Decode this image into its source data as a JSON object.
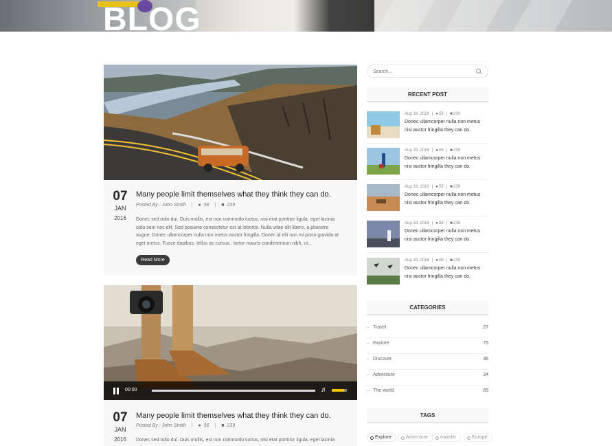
{
  "hero": {
    "title": "BLOG"
  },
  "posts": [
    {
      "day": "07",
      "month": "JAN",
      "year": "2016",
      "title": "Many people limit themselves what they think they can do.",
      "author": "Posted By : John Smith",
      "likes": "56",
      "comments": "239",
      "excerpt": "Donec sed odio dui. Duis mollis, est non commodo luctus, nisi erat porttitor ligula, eget lacinia odio sem nec elit. Sed posuere consectetur est at lobortis. Nulla vitae elit libero, a pharetra augue. Donec ullamcorper nulla non metus auctor fringilla. Donec id elit non mi porta gravida at eget metus. Fusce dapibus, tellus ac cursus , tortor mauris condimentum nibh, ut...",
      "read_more": "Read More"
    },
    {
      "day": "07",
      "month": "JAN",
      "year": "2016",
      "title": "Many people limit themselves what they think they can do.",
      "author": "Posted By : John Smith",
      "likes": "56",
      "comments": "239",
      "excerpt": "Donec sed odio dui. Duis mollis, est non commodo luctus, nisi erat porttitor ligula, eget lacinia odio",
      "video_time": "00:00",
      "volume_level": 0.8
    }
  ],
  "sidebar": {
    "search_placeholder": "Search...",
    "recent_title": "RECENT POST",
    "recent": [
      {
        "date": "Aug 18, 2016",
        "likes": "56",
        "comments": "239",
        "text": "Donec ullamcorper nulla non metus nisi auctor fringilla they can do."
      },
      {
        "date": "Aug 18, 2016",
        "likes": "56",
        "comments": "239",
        "text": "Donec ullamcorper nulla non metus nisi auctor fringilla they can do."
      },
      {
        "date": "Aug 18, 2016",
        "likes": "56",
        "comments": "239",
        "text": "Donec ullamcorper nulla non metus nisi auctor fringilla they can do."
      },
      {
        "date": "Aug 18, 2016",
        "likes": "56",
        "comments": "239",
        "text": "Donec ullamcorper nulla non metus nisi auctor fringilla they can do."
      },
      {
        "date": "Aug 18, 2016",
        "likes": "56",
        "comments": "239",
        "text": "Donec ullamcorper nulla non metus nisi auctor fringilla they can do."
      }
    ],
    "categories_title": "CATEGORIES",
    "categories": [
      {
        "name": "Travel",
        "count": "27"
      },
      {
        "name": "Explore",
        "count": "75"
      },
      {
        "name": "Discover",
        "count": "35"
      },
      {
        "name": "Adventure",
        "count": "34"
      },
      {
        "name": "The world",
        "count": "65"
      }
    ],
    "tags_title": "TAGS",
    "tags": [
      "Explore",
      "Adventure",
      "traveler",
      "Europe"
    ]
  },
  "icons": {
    "like": "user-icon",
    "comment": "comment-icon",
    "search": "search-icon"
  },
  "colors": {
    "accent": "#f5c400",
    "button": "#3a3a3a"
  }
}
